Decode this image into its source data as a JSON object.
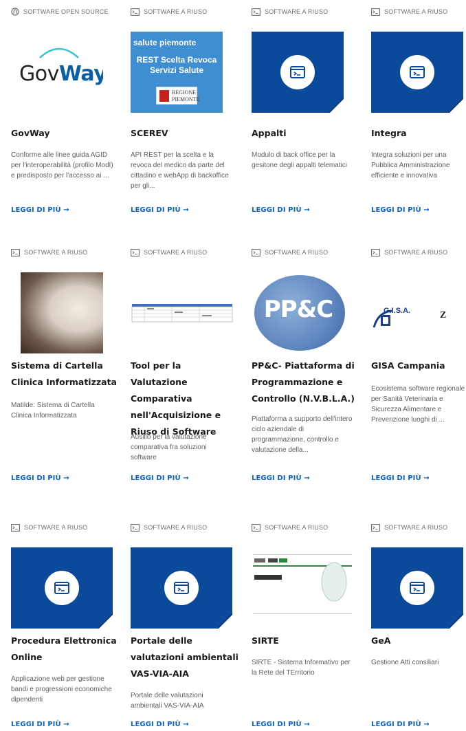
{
  "more_label": "LEGGI DI PIÙ →",
  "colors": {
    "accent": "#0b63c7",
    "tile_blue": "#0b4a9b",
    "category_gray": "#6b6f73"
  },
  "cards": [
    {
      "category": "SOFTWARE OPEN SOURCE",
      "category_icon": "open-source-icon",
      "thumb": "govway-logo",
      "logo_text_a": "Gov",
      "logo_text_b": "Way",
      "title": "GovWay",
      "description": "Conforme alle linee guida AGID per l'interoperabilità (profilo ModI) e predisposto per l'accesso ai ..."
    },
    {
      "category": "SOFTWARE A RIUSO",
      "category_icon": "terminal-icon",
      "thumb": "scerev-logo",
      "logo_badge": "salute piemonte",
      "logo_text": "REST Scelta Revoca Servizi Salute",
      "logo_region": "REGIONE PIEMONTE",
      "title": "SCEREV",
      "description": "API REST per la scelta e la revoca del medico da parte del cittadino e webApp di backoffice per gli..."
    },
    {
      "category": "SOFTWARE A RIUSO",
      "category_icon": "terminal-icon",
      "thumb": "placeholder",
      "title": "Appalti",
      "description": "Modulo di back office per la gesitone degli appalti telematici"
    },
    {
      "category": "SOFTWARE A RIUSO",
      "category_icon": "terminal-icon",
      "thumb": "placeholder",
      "title": "Integra",
      "description": "Integra soluzioni per una Pubblica Amministrazione efficiente e innovativa"
    },
    {
      "category": "SOFTWARE A RIUSO",
      "category_icon": "terminal-icon",
      "thumb": "portrait",
      "title": "Sistema di Cartella Clinica Informatizzata",
      "description": "Matilde: Sistema di Cartella Clinica Informatizzata"
    },
    {
      "category": "SOFTWARE A RIUSO",
      "category_icon": "terminal-icon",
      "thumb": "spreadsheet",
      "title": "Tool per la Valutazione Comparativa nell'Acquisizione e Riuso di Software",
      "description": "Ausilio per la valutazione comparativa fra soluzioni software"
    },
    {
      "category": "SOFTWARE A RIUSO",
      "category_icon": "terminal-icon",
      "thumb": "ppc-logo",
      "logo_text": "PP&C",
      "title": "PP&C- Piattaforma di Programmazione e Controllo (N.V.B.L.A.)",
      "description": "Piattaforma a supporto dell'intero ciclo aziendale di programmazione, controllo e valutazione della..."
    },
    {
      "category": "SOFTWARE A RIUSO",
      "category_icon": "terminal-icon",
      "thumb": "gisa-logo",
      "logo_text": "G.I.S.A.",
      "title": "GISA Campania",
      "description": "Ecosistema software regionale per Sanità Veterinaria e Sicurezza Alimentare e Prevenzione luoghi di ..."
    },
    {
      "category": "SOFTWARE A RIUSO",
      "category_icon": "terminal-icon",
      "thumb": "placeholder",
      "title": "Procedura Elettronica Online",
      "description": "Applicazione web per gestione bandi e progressioni economiche dipendenti"
    },
    {
      "category": "SOFTWARE A RIUSO",
      "category_icon": "terminal-icon",
      "thumb": "placeholder",
      "title": "Portale delle valutazioni ambientali VAS-VIA-AIA",
      "description": "Portale delle valutazioni ambientali VAS-VIA-AIA"
    },
    {
      "category": "SOFTWARE A RIUSO",
      "category_icon": "terminal-icon",
      "thumb": "sirte-logo",
      "title": "SIRTE",
      "description": "SIRTE - Sistema Informativo per la Rete del TErritorio"
    },
    {
      "category": "SOFTWARE A RIUSO",
      "category_icon": "terminal-icon",
      "thumb": "placeholder",
      "title": "GeA",
      "description": "Gestione Atti consiliari"
    }
  ]
}
